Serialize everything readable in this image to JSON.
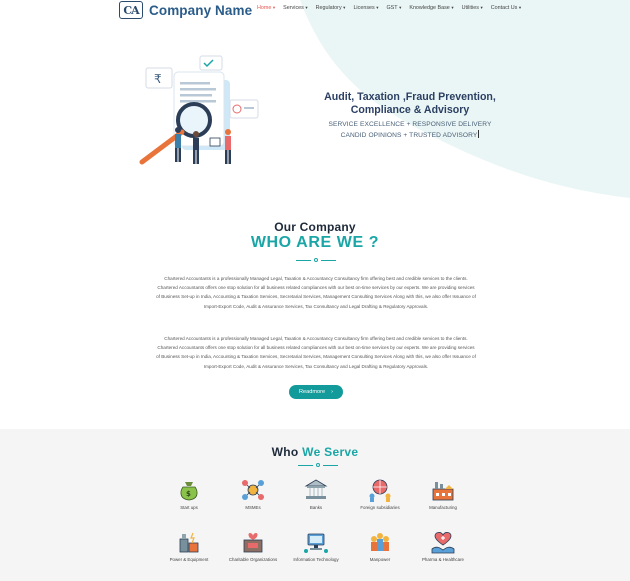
{
  "brand": {
    "logo_mark": "CA",
    "name": "Company Name"
  },
  "nav": {
    "items": [
      {
        "label": "Home",
        "caret": true,
        "active": true
      },
      {
        "label": "Services",
        "caret": true
      },
      {
        "label": "Regulatory",
        "caret": true
      },
      {
        "label": "Licenses",
        "caret": true
      },
      {
        "label": "GST",
        "caret": true
      },
      {
        "label": "Knowledge Base",
        "caret": true
      },
      {
        "label": "Utilities",
        "caret": true
      },
      {
        "label": "Contact Us",
        "caret": true
      }
    ]
  },
  "hero": {
    "title_line1": "Audit, Taxation ,Fraud Prevention,",
    "title_line2": "Compliance & Advisory",
    "sub_line1": "SERVICE EXCELLENCE + RESPONSIVE DELIVERY",
    "sub_line2": "CANDID OPINIONS + TRUSTED ADVISORY"
  },
  "about": {
    "kicker": "Our Company",
    "title": "WHO ARE WE ?",
    "paragraph1": "Chartered Accountants is a professionally Managed Legal, Taxation & Accountancy Consultancy firm offering best and credible services to the clients. Chartered Accountants offers one stop solution for all business related compliances with our best on-time services by our experts. We are providing services of Business Set-up in India, Accounting & Taxation Services, Secretarial Services, Management Consulting Services Along with this, we also offer Issuance of Import-Export Code, Audit & Assurance Services, Tax Consultancy and Legal Drafting & Regulatory Approvals.",
    "paragraph2": "Chartered Accountants is a professionally Managed Legal, Taxation & Accountancy Consultancy firm offering best and credible services to the clients. Chartered Accountants offers one stop solution for all business related compliances with our best on-time services by our experts. We are providing services of Business Set-up in India, Accounting & Taxation Services, Secretarial Services, Management Consulting Services Along with this, we also offer Issuance of Import-Export Code, Audit & Assurance Services, Tax Consultancy and Legal Drafting & Regulatory Approvals.",
    "readmore_label": "Readmore"
  },
  "serve": {
    "title_plain": "Who",
    "title_highlight": "We Serve",
    "items": [
      {
        "label": "Start ups",
        "icon": "money-bag-icon"
      },
      {
        "label": "MSMEs",
        "icon": "network-people-icon"
      },
      {
        "label": "Banks",
        "icon": "bank-icon"
      },
      {
        "label": "Foreign subsidiaries",
        "icon": "globe-people-icon"
      },
      {
        "label": "Manufacturing",
        "icon": "factory-icon"
      },
      {
        "label": "Power & Equipment",
        "icon": "power-plant-icon"
      },
      {
        "label": "Charitable Organizations",
        "icon": "charity-box-icon"
      },
      {
        "label": "Information Technology",
        "icon": "computer-network-icon"
      },
      {
        "label": "Manpower",
        "icon": "workers-group-icon"
      },
      {
        "label": "Pharma & Healthcare",
        "icon": "heart-hands-icon"
      }
    ]
  },
  "colors": {
    "accent": "#1aa6a6",
    "navy": "#2b3f63",
    "nav_active": "#e8554e",
    "hero_blob": "#e8f5f4"
  }
}
